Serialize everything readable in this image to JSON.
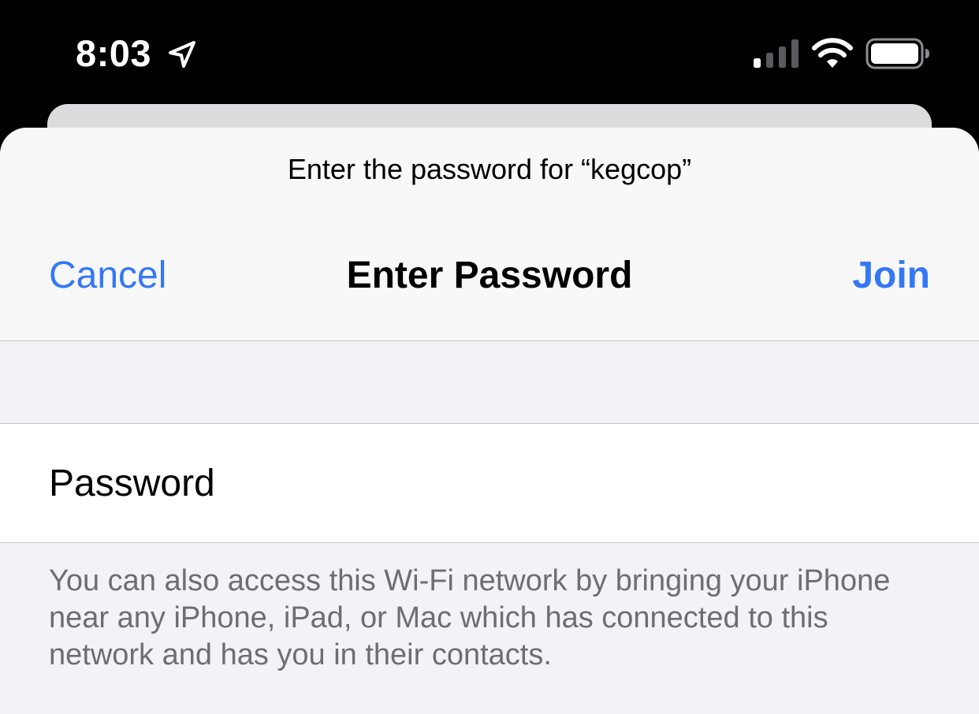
{
  "status_bar": {
    "time": "8:03",
    "location_icon": "location-arrow-icon",
    "signal_icon": "cellular-signal-icon",
    "wifi_icon": "wifi-icon",
    "battery_icon": "battery-icon"
  },
  "sheet": {
    "prompt": "Enter the password for “kegcop”",
    "title": "Enter Password",
    "cancel_label": "Cancel",
    "join_label": "Join"
  },
  "form": {
    "password_label": "Password",
    "password_value": ""
  },
  "footer": {
    "note": "You can also access this Wi-Fi network by bringing your iPhone near any iPhone, iPad, or Mac which has connected to this network and has you in their contacts."
  },
  "colors": {
    "accent": "#3478f6",
    "background": "#f2f2f7",
    "secondary_text": "#6d6d72"
  }
}
